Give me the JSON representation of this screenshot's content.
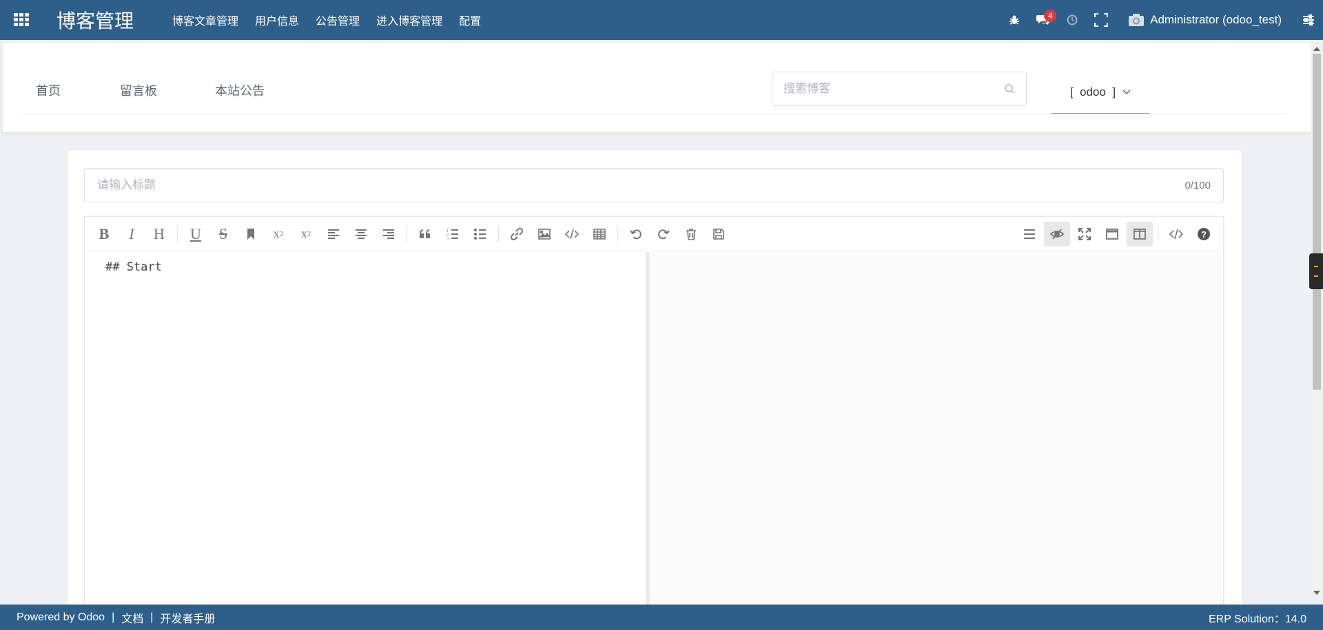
{
  "navbar": {
    "brand": "博客管理",
    "menu": [
      {
        "label": "博客文章管理"
      },
      {
        "label": "用户信息"
      },
      {
        "label": "公告管理"
      },
      {
        "label": "进入博客管理"
      },
      {
        "label": "配置"
      }
    ],
    "messages_badge": "4",
    "user": "Administrator (odoo_test)"
  },
  "blog_header": {
    "tabs": [
      {
        "label": "首页"
      },
      {
        "label": "留言板"
      },
      {
        "label": "本站公告"
      }
    ],
    "search_placeholder": "搜索博客",
    "user_tab": "[  odoo  ]"
  },
  "editor": {
    "title_placeholder": "请输入标题",
    "counter": "0/100",
    "content": "## Start",
    "toolbar_left": [
      "bold-icon",
      "italic-icon",
      "heading-icon",
      "underline-icon",
      "strikethrough-icon",
      "mark-icon",
      "superscript-icon",
      "subscript-icon",
      "align-left-icon",
      "align-center-icon",
      "align-right-icon",
      "quote-icon",
      "ordered-list-icon",
      "unordered-list-icon",
      "link-icon",
      "image-icon",
      "code-icon",
      "table-icon",
      "undo-icon",
      "redo-icon",
      "trash-icon",
      "save-icon"
    ],
    "toolbar_right": [
      "navigation-icon",
      "preview-toggle-icon",
      "fullscreen-icon",
      "read-mode-icon",
      "subfield-icon",
      "html-code-icon",
      "help-icon"
    ]
  },
  "footer": {
    "powered": "Powered by Odoo",
    "sep": "|",
    "docs": "文档",
    "dev_manual": "开发者手册",
    "solution": "ERP Solution：14.0"
  },
  "colors": {
    "navbar": "#2e5f8b",
    "badge": "#e03a3a",
    "active_tab_underline": "#409eff"
  }
}
